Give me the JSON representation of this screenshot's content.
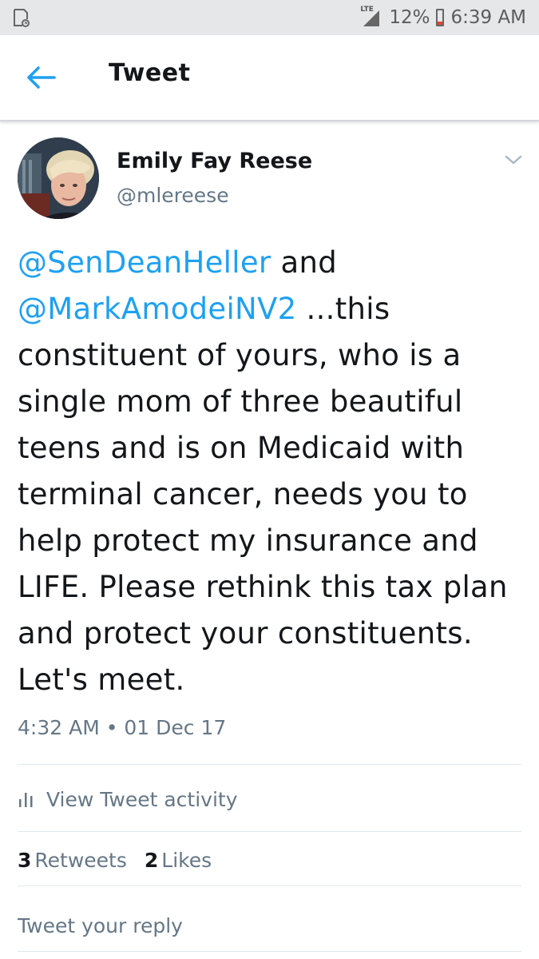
{
  "status_bar": {
    "network": "LTE",
    "battery_percent": "12%",
    "time": "6:39 AM",
    "battery_level": 0.12,
    "battery_color": "#e8452c"
  },
  "app_bar": {
    "title": "Tweet",
    "back_icon": "arrow-left-icon",
    "accent_color": "#1da1f2"
  },
  "tweet": {
    "author_name": "Emily Fay Reese",
    "author_handle": "@mlereese",
    "text_parts": {
      "mention_1": "@SenDeanHeller",
      "connector": " and ",
      "mention_2": "@MarkAmodeiNV2",
      "body": " ...this constituent of yours, who is a single mom of three beautiful teens and is on Medicaid with terminal cancer, needs you to help protect my insurance and LIFE. Please rethink this tax plan and protect your constituents. Let's meet."
    },
    "timestamp": "4:32 AM • 01 Dec 17",
    "activity_label": "View Tweet activity",
    "retweets_count": "3",
    "retweets_label": "Retweets",
    "likes_count": "2",
    "likes_label": "Likes"
  },
  "reply": {
    "placeholder": "Tweet your reply"
  }
}
